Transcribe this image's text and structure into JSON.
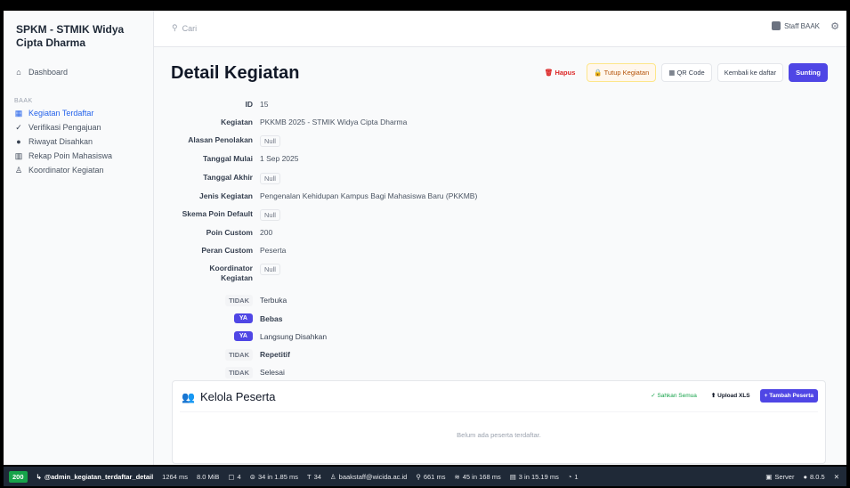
{
  "sidebar": {
    "brand": "SPKM - STMIK Widya Cipta Dharma",
    "dashboard": "Dashboard",
    "group_label": "BAAK",
    "items": [
      {
        "label": "Kegiatan Terdaftar",
        "icon": "calendar-icon"
      },
      {
        "label": "Verifikasi Pengajuan",
        "icon": "check-icon"
      },
      {
        "label": "Riwayat Disahkan",
        "icon": "history-icon"
      },
      {
        "label": "Rekap Poin Mahasiswa",
        "icon": "chart-icon"
      },
      {
        "label": "Koordinator Kegiatan",
        "icon": "user-icon"
      }
    ]
  },
  "topbar": {
    "search_placeholder": "Cari",
    "user_name": "Staff BAAK"
  },
  "page": {
    "title": "Detail Kegiatan",
    "actions": {
      "delete": "Hapus",
      "close": "Tutup Kegiatan",
      "qr": "QR Code",
      "back": "Kembali ke daftar",
      "edit": "Sunting"
    }
  },
  "details": {
    "id_label": "ID",
    "id_value": "15",
    "kegiatan_label": "Kegiatan",
    "kegiatan_value": "PKKMB 2025 - STMIK Widya Cipta Dharma",
    "alasan_label": "Alasan Penolakan",
    "null_text": "Null",
    "tgl_mulai_label": "Tanggal Mulai",
    "tgl_mulai_value": "1 Sep 2025",
    "tgl_akhir_label": "Tanggal Akhir",
    "jenis_label": "Jenis Kegiatan",
    "jenis_value": "Pengenalan Kehidupan Kampus Bagi Mahasiswa Baru (PKKMB)",
    "skema_label": "Skema Poin Default",
    "poin_label": "Poin Custom",
    "poin_value": "200",
    "peran_label": "Peran Custom",
    "peran_value": "Peserta",
    "koordinator_label_1": "Koordinator",
    "koordinator_label_2": "Kegiatan"
  },
  "flags": {
    "no": "TIDAK",
    "yes": "YA",
    "terbuka": "Terbuka",
    "bebas": "Bebas",
    "langsung": "Langsung Disahkan",
    "repetitif": "Repetitif",
    "selesai": "Selesai"
  },
  "peserta": {
    "title": "Kelola Peserta",
    "sahkan": "Sahkan Semua",
    "upload": "Upload XLS",
    "tambah": "+ Tambah Peserta",
    "empty": "Belum ada peserta terdaftar."
  },
  "debugbar": {
    "status": "200",
    "route": "@admin_kegiatan_terdaftar_detail",
    "time": "1264 ms",
    "memory": "8.0 MiB",
    "forms": "4",
    "cache": "34 in 1.85 ms",
    "translations": "34",
    "user": "baakstaff@wicida.ac.id",
    "queries": "661 ms",
    "twig": "45 in 168 ms",
    "db": "3 in 15.19 ms",
    "events": "1",
    "server": "Server",
    "version": "8.0.5"
  },
  "colors": {
    "primary": "#4f46e5",
    "danger": "#dc2626",
    "success": "#16a34a"
  }
}
